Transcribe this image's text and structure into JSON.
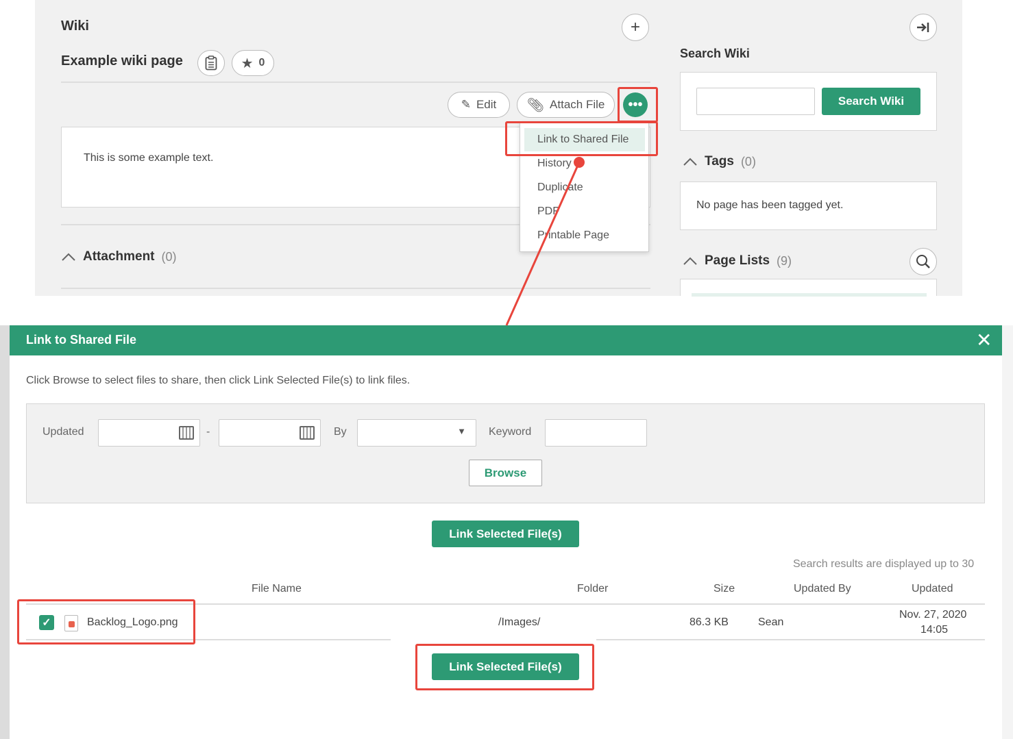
{
  "wiki": {
    "title": "Wiki",
    "page_name": "Example wiki page",
    "star_count": "0",
    "edit_label": "Edit",
    "attach_label": "Attach File",
    "more_label": "•••",
    "content_text": "This is some example text.",
    "menu": [
      "Link to Shared File",
      "History",
      "Duplicate",
      "PDF",
      "Printable Page"
    ],
    "attachment_label": "Attachment",
    "attachment_count": "(0)"
  },
  "sidebar": {
    "search_title": "Search Wiki",
    "search_button": "Search Wiki",
    "tags_label": "Tags",
    "tags_count": "(0)",
    "tags_empty": "No page has been tagged yet.",
    "pagelists_label": "Page Lists",
    "pagelists_count": "(9)"
  },
  "modal": {
    "title": "Link to Shared File",
    "close": "✕",
    "instructions": "Click Browse to select files to share, then click Link Selected File(s) to link files.",
    "filter": {
      "updated_label": "Updated",
      "dash": "-",
      "by_label": "By",
      "keyword_label": "Keyword",
      "browse_label": "Browse"
    },
    "link_button": "Link Selected File(s)",
    "note": "Search results are displayed up to 30",
    "columns": [
      "File Name",
      "Folder",
      "Size",
      "Updated By",
      "Updated"
    ],
    "row": {
      "file_name": "Backlog_Logo.png",
      "folder": "/Images/",
      "size": "86.3 KB",
      "updated_by": "Sean",
      "updated_date": "Nov. 27, 2020",
      "updated_time": "14:05"
    }
  },
  "colors": {
    "accent": "#2d9a74",
    "highlight": "#e8453c"
  }
}
